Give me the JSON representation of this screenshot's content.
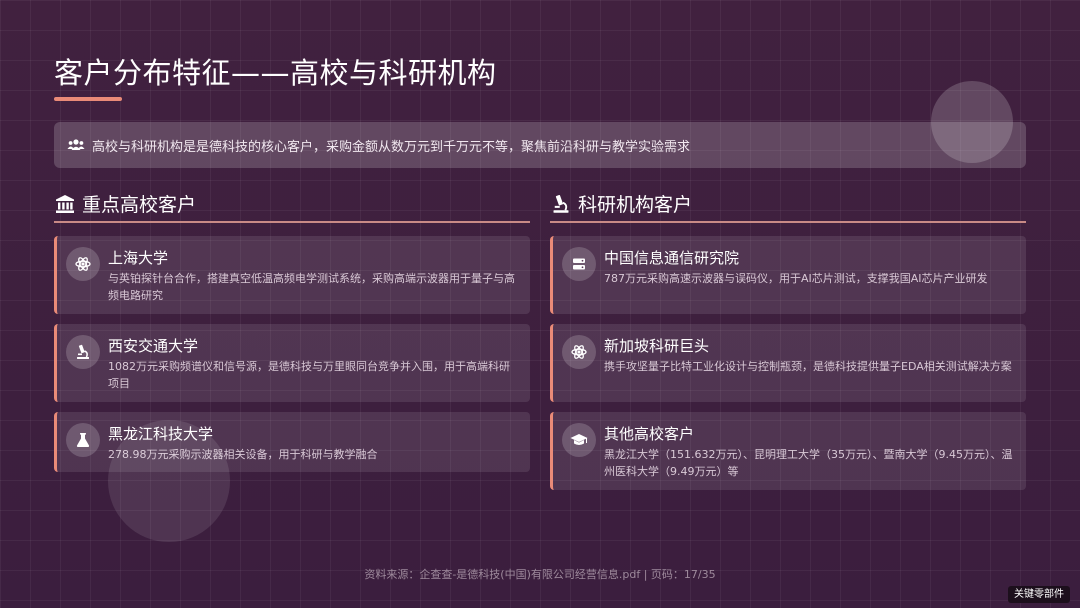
{
  "title": "客户分布特征——高校与科研机构",
  "banner": {
    "icon": "users-icon",
    "text": "高校与科研机构是是德科技的核心客户，采购金额从数万元到千万元不等，聚焦前沿科研与教学实验需求"
  },
  "left_section": {
    "icon": "university-icon",
    "heading": "重点高校客户",
    "cards": [
      {
        "icon": "atom-icon",
        "title": "上海大学",
        "desc": "与英铂探针台合作，搭建真空低温高频电学测试系统，采购高端示波器用于量子与高频电路研究"
      },
      {
        "icon": "microscope-icon",
        "title": "西安交通大学",
        "desc": "1082万元采购频谱仪和信号源，是德科技与万里眼同台竞争并入围，用于高端科研项目"
      },
      {
        "icon": "flask-icon",
        "title": "黑龙江科技大学",
        "desc": "278.98万元采购示波器相关设备，用于科研与教学融合"
      }
    ]
  },
  "right_section": {
    "icon": "microscope-icon",
    "heading": "科研机构客户",
    "cards": [
      {
        "icon": "server-icon",
        "title": "中国信息通信研究院",
        "desc": "787万元采购高速示波器与误码仪，用于AI芯片测试，支撑我国AI芯片产业研发"
      },
      {
        "icon": "atom-icon",
        "title": "新加坡科研巨头",
        "desc": "携手攻坚量子比特工业化设计与控制瓶颈，是德科技提供量子EDA相关测试解决方案"
      },
      {
        "icon": "graduation-cap-icon",
        "title": "其他高校客户",
        "desc": "黑龙江大学（151.632万元）、昆明理工大学（35万元）、暨南大学（9.45万元）、温州医科大学（9.49万元）等"
      }
    ]
  },
  "footer": "资料来源：企查查-是德科技(中国)有限公司经营信息.pdf | 页码：17/35",
  "watermark": "关键零部件",
  "colors": {
    "accent": "#ea8b78",
    "background": "#3d1f3f"
  }
}
